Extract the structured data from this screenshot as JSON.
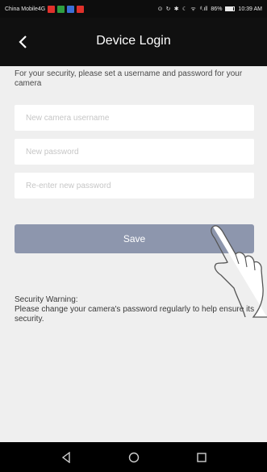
{
  "status_bar": {
    "carrier": "China Mobile4G",
    "sys_glyphs": "⊙ ↻ ✱ ☾ ᯤ",
    "signal": "ᵈ.ıll",
    "battery_percent": "86%",
    "battery_level": 0.86,
    "time": "10:39 AM",
    "notif_colors": [
      "#e0312b",
      "#2f9e41",
      "#3b6fd8",
      "#e0312b"
    ]
  },
  "header": {
    "title": "Device Login",
    "back_icon": "chevron-left-icon"
  },
  "form": {
    "intro": "For your security, please set a username and password for your camera",
    "username_placeholder": "New camera username",
    "password_placeholder": "New password",
    "confirm_placeholder": "Re-enter new password",
    "save_label": "Save"
  },
  "warning": {
    "title": "Security Warning:",
    "body": "Please change your camera's password regularly to help ensure its security."
  },
  "colors": {
    "save_button": "#8d96ad",
    "header_bg": "#101010",
    "page_bg": "#efefef"
  },
  "nav": {
    "back": "back-triangle-icon",
    "home": "home-circle-icon",
    "recents": "recents-square-icon"
  }
}
